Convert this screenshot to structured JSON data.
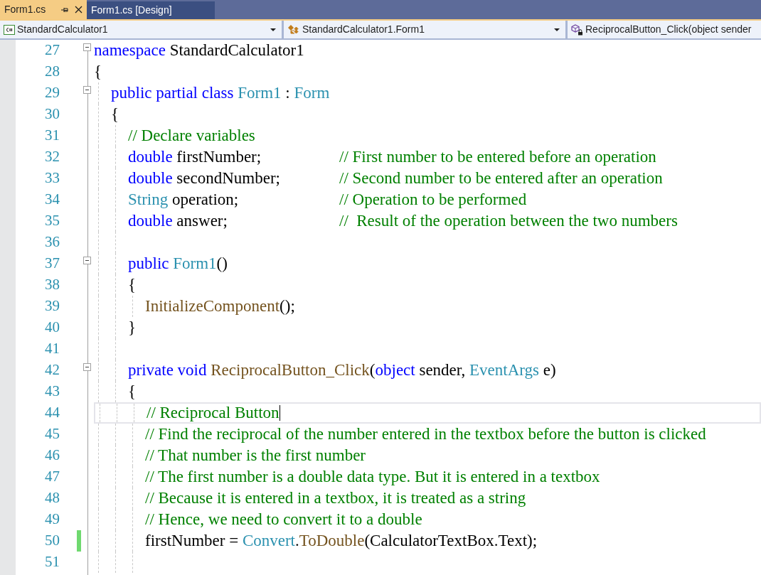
{
  "tabs": [
    {
      "label": "Form1.cs",
      "selected": true
    },
    {
      "label": "Form1.cs [Design]",
      "selected": false
    }
  ],
  "navigation_bar": [
    {
      "kind": "project",
      "text": "StandardCalculator1",
      "dropdown": true
    },
    {
      "kind": "class",
      "text": "StandardCalculator1.Form1",
      "dropdown": true
    },
    {
      "kind": "method",
      "text": "ReciprocalButton_Click(object sender",
      "dropdown": false
    }
  ],
  "editor": {
    "lines": [
      {
        "number": "27",
        "expanded": true,
        "current": false,
        "changed": false,
        "tokens": [
          {
            "kind": "keyword",
            "text": "namespace"
          },
          {
            "kind": "plain",
            "text": " StandardCalculator1"
          }
        ]
      },
      {
        "number": "28",
        "current": false,
        "changed": false,
        "tokens": [
          {
            "kind": "plain",
            "text": "{"
          }
        ],
        "children": [
          {
            "number": "29",
            "expanded": true,
            "current": false,
            "changed": false,
            "tokens": [
              {
                "kind": "keyword",
                "text": "public partial class "
              },
              {
                "kind": "type",
                "text": "Form1"
              },
              {
                "kind": "plain",
                "text": " : "
              },
              {
                "kind": "type",
                "text": "Form"
              }
            ]
          },
          {
            "number": "30",
            "current": false,
            "changed": false,
            "tokens": [
              {
                "kind": "plain",
                "text": "{"
              }
            ],
            "children": [
              {
                "number": "31",
                "current": false,
                "changed": false,
                "tokens": [
                  {
                    "kind": "comment",
                    "text": "// Declare variables"
                  }
                ]
              },
              {
                "number": "32",
                "current": false,
                "changed": false,
                "tokens": [
                  {
                    "kind": "keyword",
                    "text": "double"
                  },
                  {
                    "kind": "plain",
                    "text": " firstNumber;"
                  }
                ],
                "trailing_comment": "// First number to be entered before an operation"
              },
              {
                "number": "33",
                "current": false,
                "changed": false,
                "tokens": [
                  {
                    "kind": "keyword",
                    "text": "double"
                  },
                  {
                    "kind": "plain",
                    "text": " secondNumber;"
                  }
                ],
                "trailing_comment": "// Second number to be entered after an operation"
              },
              {
                "number": "34",
                "current": false,
                "changed": false,
                "tokens": [
                  {
                    "kind": "type",
                    "text": "String"
                  },
                  {
                    "kind": "plain",
                    "text": " operation;"
                  }
                ],
                "trailing_comment": "// Operation to be performed"
              },
              {
                "number": "35",
                "current": false,
                "changed": false,
                "tokens": [
                  {
                    "kind": "keyword",
                    "text": "double"
                  },
                  {
                    "kind": "plain",
                    "text": " answer;"
                  }
                ],
                "trailing_comment": "//  Result of the operation between the two numbers"
              },
              {
                "number": "36",
                "current": false,
                "changed": false
              },
              {
                "number": "37",
                "expanded": true,
                "current": false,
                "changed": false,
                "tokens": [
                  {
                    "kind": "keyword",
                    "text": "public "
                  },
                  {
                    "kind": "type",
                    "text": "Form1"
                  },
                  {
                    "kind": "plain",
                    "text": "()"
                  }
                ]
              },
              {
                "number": "38",
                "current": false,
                "changed": false,
                "tokens": [
                  {
                    "kind": "plain",
                    "text": "{"
                  }
                ],
                "children": [
                  {
                    "number": "39",
                    "current": false,
                    "changed": false,
                    "tokens": [
                      {
                        "kind": "method",
                        "text": "InitializeComponent"
                      },
                      {
                        "kind": "plain",
                        "text": "();"
                      }
                    ]
                  }
                ]
              },
              {
                "number": "40",
                "current": false,
                "changed": false,
                "tokens": [
                  {
                    "kind": "plain",
                    "text": "}"
                  }
                ]
              },
              {
                "number": "41",
                "current": false,
                "changed": false
              },
              {
                "number": "42",
                "expanded": true,
                "current": false,
                "changed": false,
                "tokens": [
                  {
                    "kind": "keyword",
                    "text": "private void "
                  },
                  {
                    "kind": "method",
                    "text": "ReciprocalButton_Click"
                  },
                  {
                    "kind": "plain",
                    "text": "("
                  },
                  {
                    "kind": "keyword",
                    "text": "object"
                  },
                  {
                    "kind": "plain",
                    "text": " sender, "
                  },
                  {
                    "kind": "type",
                    "text": "EventArgs"
                  },
                  {
                    "kind": "plain",
                    "text": " e)"
                  }
                ]
              },
              {
                "number": "43",
                "current": false,
                "changed": false,
                "tokens": [
                  {
                    "kind": "plain",
                    "text": "{"
                  }
                ],
                "children": [
                  {
                    "number": "44",
                    "current": true,
                    "changed": false,
                    "tokens": [
                      {
                        "kind": "comment",
                        "text": "// Reciprocal Button"
                      }
                    ]
                  },
                  {
                    "number": "45",
                    "current": false,
                    "changed": false,
                    "tokens": [
                      {
                        "kind": "comment",
                        "text": "// Find the reciprocal of the number entered in the textbox before the button is clicked"
                      }
                    ]
                  },
                  {
                    "number": "46",
                    "current": false,
                    "changed": false,
                    "tokens": [
                      {
                        "kind": "comment",
                        "text": "// That number is the first number"
                      }
                    ]
                  },
                  {
                    "number": "47",
                    "current": false,
                    "changed": false,
                    "tokens": [
                      {
                        "kind": "comment",
                        "text": "// The first number is a double data type. But it is entered in a textbox"
                      }
                    ]
                  },
                  {
                    "number": "48",
                    "current": false,
                    "changed": false,
                    "tokens": [
                      {
                        "kind": "comment",
                        "text": "// Because it is entered in a textbox, it is treated as a string"
                      }
                    ]
                  },
                  {
                    "number": "49",
                    "current": false,
                    "changed": false,
                    "tokens": [
                      {
                        "kind": "comment",
                        "text": "// Hence, we need to convert it to a double"
                      }
                    ]
                  },
                  {
                    "number": "50",
                    "current": false,
                    "changed": true,
                    "tokens": [
                      {
                        "kind": "plain",
                        "text": "firstNumber = "
                      },
                      {
                        "kind": "type",
                        "text": "Convert"
                      },
                      {
                        "kind": "plain",
                        "text": "."
                      },
                      {
                        "kind": "method",
                        "text": "ToDouble"
                      },
                      {
                        "kind": "plain",
                        "text": "(CalculatorTextBox.Text);"
                      }
                    ]
                  },
                  {
                    "number": "51",
                    "current": false,
                    "changed": false
                  }
                ]
              }
            ]
          }
        ]
      }
    ]
  }
}
